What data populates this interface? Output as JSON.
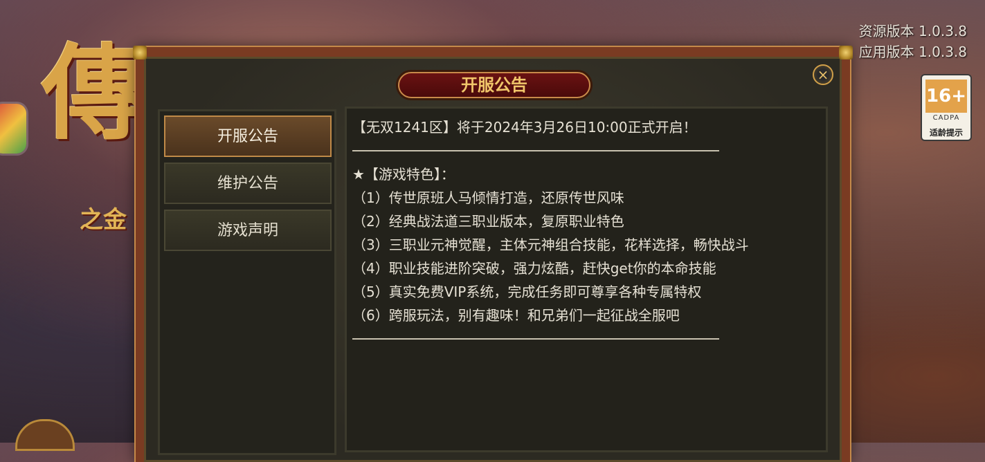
{
  "background": {
    "logo_glyph": "傳",
    "logo_sub": "之金"
  },
  "version": {
    "resource": "资源版本 1.0.3.8",
    "app": "应用版本 1.0.3.8"
  },
  "age_badge": {
    "rating": "16+",
    "org": "CADPA",
    "tip": "适龄提示"
  },
  "dialog": {
    "title": "开服公告",
    "close_symbol": "×",
    "tabs": [
      {
        "label": "开服公告",
        "active": true
      },
      {
        "label": "维护公告",
        "active": false
      },
      {
        "label": "游戏声明",
        "active": false
      }
    ],
    "content": {
      "headline": "【无双1241区】将于2024年3月26日10:00正式开启！",
      "features_title": "★【游戏特色】：",
      "features": [
        "（1）传世原班人马倾情打造，还原传世风味",
        "（2）经典战法道三职业版本，复原职业特色",
        "（3）三职业元神觉醒，主体元神组合技能，花样选择，畅快战斗",
        "（4）职业技能进阶突破，强力炫酷，赶快get你的本命技能",
        "（5）真实免费VIP系统，完成任务即可尊享各种专属特权",
        "（6）跨服玩法，别有趣味！和兄弟们一起征战全服吧"
      ]
    }
  }
}
